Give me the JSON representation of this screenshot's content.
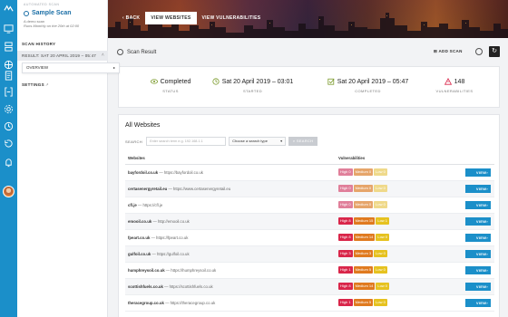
{
  "rail": {
    "icons": [
      "logo-icon",
      "monitor-icon",
      "server-icon",
      "globe-icon",
      "document-icon",
      "bracket-icon",
      "settings-icon",
      "clock-icon",
      "history-icon",
      "bell-icon",
      "avatar"
    ]
  },
  "nav": {
    "kicker": "AUTOMATED SCAN",
    "scan_name": "Sample Scan",
    "scan_desc": "A demo scan",
    "scan_runs": "Runs Monthly on the 20th at 02:00",
    "history_title": "SCAN HISTORY",
    "history_item": "RESULT: SAT 20 APRIL 2019 – 05:47",
    "overview": "OVERVIEW",
    "settings": "SETTINGS"
  },
  "header": {
    "back": "BACK",
    "tab_websites": "VIEW WEBSITES",
    "tab_vulns": "VIEW VULNERABILITIES"
  },
  "toolbar": {
    "title": "Scan Result",
    "add_scan": "ADD SCAN"
  },
  "stats": {
    "status_value": "Completed",
    "status_label": "STATUS",
    "started_value": "Sat 20 April 2019 – 03:01",
    "started_label": "STARTED",
    "completed_value": "Sat 20 April 2019 – 05:47",
    "completed_label": "COMPLETED",
    "vulns_value": "148",
    "vulns_label": "VULNERABILITIES"
  },
  "sites": {
    "title": "All Websites",
    "search_label": "SEARCH",
    "search_placeholder": "Enter search term e.g. 192.168.1.1",
    "search_type": "Choose a search type",
    "search_button": "SEARCH",
    "col_websites": "Websites",
    "col_vulns": "Vulnerabilities",
    "view_label": "VIEW",
    "rows": [
      {
        "domain": "bayfordoil.co.uk",
        "url": "— https://bayfordoil.co.uk",
        "high": "High 0",
        "med": "Medium 0",
        "low": "Low 0",
        "hot": false
      },
      {
        "domain": "certasenergyretail.eu",
        "url": "— https://www.certasenergyretail.eu",
        "high": "High 0",
        "med": "Medium 0",
        "low": "Low 0",
        "hot": false
      },
      {
        "domain": "cfl.je",
        "url": "— https://cfl.je",
        "high": "High 0",
        "med": "Medium 0",
        "low": "Low 0",
        "hot": false
      },
      {
        "domain": "emooil.co.uk",
        "url": "— http://emooil.co.uk",
        "high": "High 8",
        "med": "Medium 15",
        "low": "Low 1",
        "hot": true
      },
      {
        "domain": "fpeart.co.uk",
        "url": "— https://fpeart.co.uk",
        "high": "High 8",
        "med": "Medium 14",
        "low": "Low 0",
        "hot": true
      },
      {
        "domain": "gulfoil.co.uk",
        "url": "— https://gulfoil.co.uk",
        "high": "High 3",
        "med": "Medium 3",
        "low": "Low 0",
        "hot": true
      },
      {
        "domain": "humphreysoil.co.uk",
        "url": "— https://humphreysoil.co.uk",
        "high": "High 1",
        "med": "Medium 5",
        "low": "Low 0",
        "hot": true
      },
      {
        "domain": "scottishfuels.co.uk",
        "url": "— https://scottishfuels.co.uk",
        "high": "High 8",
        "med": "Medium 14",
        "low": "Low 0",
        "hot": true
      },
      {
        "domain": "theracegroup.co.uk",
        "url": "— https://theracegroup.co.uk",
        "high": "High 1",
        "med": "Medium 5",
        "low": "Low 0",
        "hot": true
      }
    ]
  }
}
